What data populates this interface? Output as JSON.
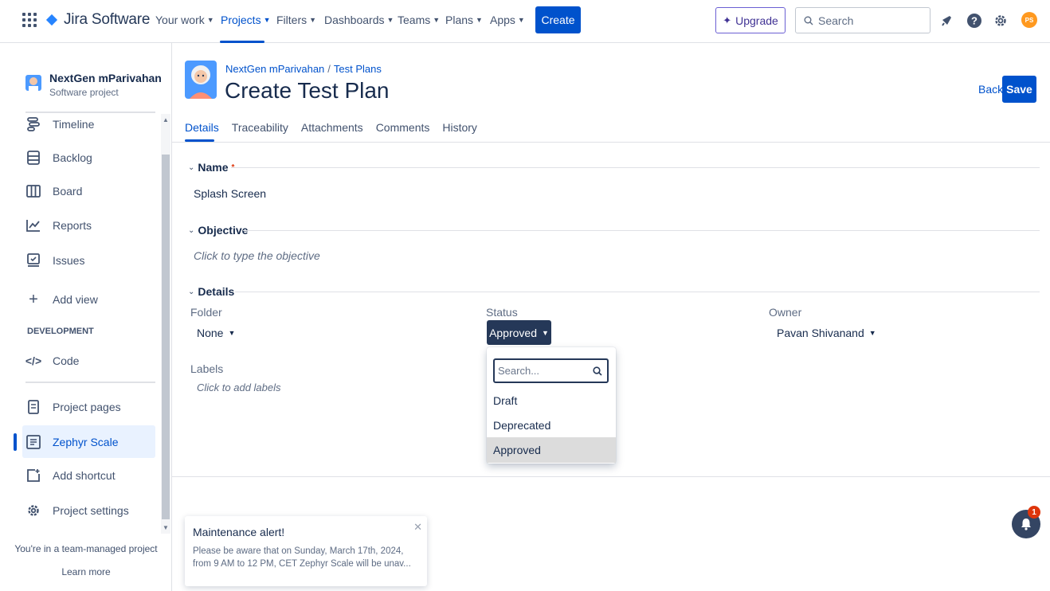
{
  "topnav": {
    "app_name": "Jira Software",
    "items": [
      {
        "label": "Your work"
      },
      {
        "label": "Projects"
      },
      {
        "label": "Filters"
      },
      {
        "label": "Dashboards"
      },
      {
        "label": "Teams"
      },
      {
        "label": "Plans"
      },
      {
        "label": "Apps"
      }
    ],
    "active_item": "Projects",
    "create_label": "Create",
    "upgrade_label": "Upgrade",
    "search_placeholder": "Search",
    "avatar_initials": "PS",
    "accent": "#0052cc"
  },
  "sidebar": {
    "project_name": "NextGen mParivahan",
    "project_type": "Software project",
    "items": [
      {
        "label": "Timeline",
        "icon": "timeline-icon"
      },
      {
        "label": "Backlog",
        "icon": "backlog-icon"
      },
      {
        "label": "Board",
        "icon": "board-icon"
      },
      {
        "label": "Reports",
        "icon": "reports-icon"
      },
      {
        "label": "Issues",
        "icon": "issues-icon"
      },
      {
        "label": "Add view",
        "icon": "plus-icon"
      }
    ],
    "section_development": "DEVELOPMENT",
    "dev_items": [
      {
        "label": "Code",
        "icon": "code-icon"
      }
    ],
    "bottom_items": [
      {
        "label": "Project pages",
        "icon": "page-icon"
      },
      {
        "label": "Zephyr Scale",
        "icon": "zephyr-icon"
      },
      {
        "label": "Add shortcut",
        "icon": "add-shortcut-icon"
      },
      {
        "label": "Project settings",
        "icon": "gear-icon"
      }
    ],
    "active_item": "Zephyr Scale",
    "team_note": "You're in a team-managed project",
    "learn_more": "Learn more"
  },
  "main": {
    "breadcrumb_project": "NextGen mParivahan",
    "breadcrumb_sep": "/",
    "breadcrumb_section": "Test Plans",
    "title": "Create Test Plan",
    "back_label": "Back",
    "save_label": "Save",
    "tabs": [
      {
        "label": "Details"
      },
      {
        "label": "Traceability"
      },
      {
        "label": "Attachments"
      },
      {
        "label": "Comments"
      },
      {
        "label": "History"
      }
    ],
    "active_tab": "Details",
    "name_section": "Name",
    "name_required_mark": "*",
    "name_value": "Splash Screen",
    "objective_section": "Objective",
    "objective_placeholder": "Click to type the objective",
    "details_section": "Details",
    "folder_label": "Folder",
    "folder_value": "None",
    "status_label": "Status",
    "status_value": "Approved",
    "owner_label": "Owner",
    "owner_value": "Pavan Shivanand",
    "labels_label": "Labels",
    "labels_placeholder": "Click to add labels"
  },
  "status_dropdown": {
    "search_placeholder": "Search...",
    "options": [
      {
        "label": "Draft"
      },
      {
        "label": "Deprecated"
      },
      {
        "label": "Approved"
      }
    ],
    "selected": "Approved"
  },
  "alert": {
    "title": "Maintenance alert!",
    "body": "Please be aware that on Sunday, March 17th, 2024, from 9 AM to 12 PM, CET Zephyr Scale will be unav..."
  },
  "notifications": {
    "badge_count": "1"
  }
}
